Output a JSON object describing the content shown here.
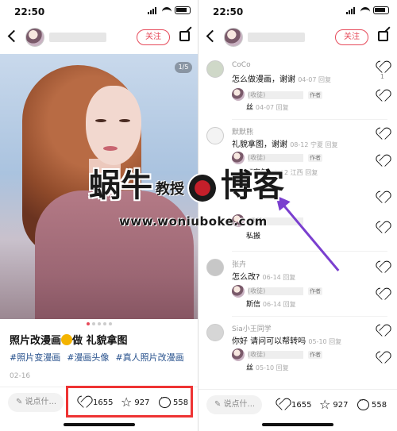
{
  "status": {
    "time_left": "22:50",
    "time_right": "22:50"
  },
  "header": {
    "follow_label": "关注",
    "author_hidden": "✓"
  },
  "post": {
    "pager": "1/5",
    "title_part1": "照片改漫画",
    "title_part2": "做 礼貌拿图",
    "tags": [
      "#照片变漫画",
      "#漫画头像",
      "#真人照片改漫画"
    ],
    "date": "02-16"
  },
  "bottom": {
    "placeholder": "说点什...",
    "likes": "1655",
    "stars": "927",
    "comments": "558"
  },
  "comments": [
    {
      "user": "CoCo",
      "text": "怎么做漫画，谢谢",
      "meta": "04-07 回复",
      "likes": "1",
      "reply_name": "(收徒)",
      "reply_badge": "作者",
      "reply_text": "丝",
      "reply_meta": "04-07 回复"
    },
    {
      "user": "默默熊",
      "text": "礼貌拿图，谢谢",
      "meta": "08-12 宁夏 回复",
      "likes": "",
      "reply_name": "(收徒)",
      "reply_badge": "作者",
      "reply_text": "不客气",
      "reply_meta": "08-12 江西 回复"
    },
    {
      "user": "",
      "text": "",
      "meta": "",
      "likes": "",
      "reply_name": "(收徒)",
      "reply_badge": "",
      "reply_text": "私搬",
      "reply_meta": ""
    },
    {
      "user": "张卉",
      "text": "怎么改?",
      "meta": "06-14 回复",
      "likes": "",
      "reply_name": "(收徒)",
      "reply_badge": "作者",
      "reply_text": "斯信",
      "reply_meta": "06-14 回复"
    },
    {
      "user": "Sia小王同学",
      "text": "你好 请问可以帮转吗",
      "meta": "05-10 回复",
      "likes": "",
      "reply_name": "(收徒)",
      "reply_badge": "作者",
      "reply_text": "丝",
      "reply_meta": "05-10 回复"
    }
  ],
  "watermark": {
    "big1": "蜗牛",
    "small": "教授",
    "big2": "博客",
    "url": "www.woniuboke.com"
  },
  "colors": {
    "accent": "#e64a5a",
    "highlight": "#ee3333",
    "arrow": "#7a3fcf"
  }
}
